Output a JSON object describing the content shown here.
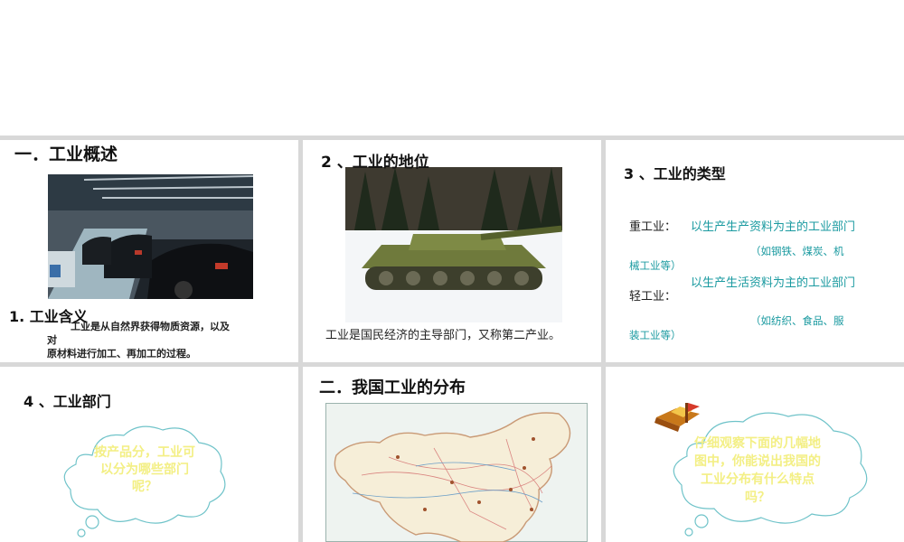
{
  "slide1": {
    "title": "一．工业概述",
    "subtitle": "1. 工业含义",
    "def_line1": "工业是从自然界获得物质资源，以及",
    "def_line2": "对",
    "def_line3": "原材料进行加工、再加工的过程。"
  },
  "slide2": {
    "title": "2 、工业的地位",
    "text": "工业是国民经济的主导部门，又称第二产业。"
  },
  "slide3": {
    "title": "3 、工业的类型",
    "heavy_label": "重工业：",
    "heavy_def": "以生产生产资料为主的工业部门",
    "heavy_ex1": "（如钢铁、煤炭、机",
    "heavy_ex2": "械工业等）",
    "light_label": "轻工业：",
    "light_def": "以生产生活资料为主的工业部门",
    "light_ex1": "（如纺织、食品、服",
    "light_ex2": "装工业等）"
  },
  "slide4": {
    "title": "4 、工业部门",
    "cloud_text": "按产品分，工业可以分为哪些部门呢？"
  },
  "slide5": {
    "title": "二．我国工业的分布"
  },
  "slide6": {
    "cloud_text": "仔细观察下面的几幅地图中，你能说出我国的工业分布有什么特点吗？"
  },
  "colors": {
    "teal": "#1a9aa0",
    "cloud_text": "#f3ef84",
    "divider": "#d8d8d8"
  }
}
